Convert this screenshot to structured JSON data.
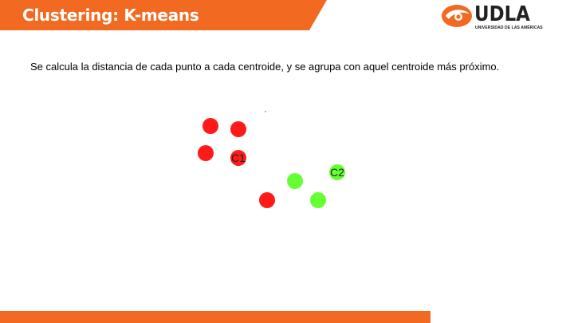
{
  "header": {
    "title": "Clustering: K-means",
    "brand_color": "#f26a21"
  },
  "logo": {
    "wordmark": "UDLA",
    "subtitle": "UNIVERSIDAD DE LAS AMÉRICAS",
    "icon": "udla-swoosh-icon"
  },
  "body": {
    "text": "Se calcula la distancia de cada punto a cada centroide, y se agrupa con aquel centroide más próximo."
  },
  "figure": {
    "red_color": "#ff1a1a",
    "green_color": "#66ff33",
    "centroid_1_label": "C1",
    "centroid_2_label": "C2"
  }
}
